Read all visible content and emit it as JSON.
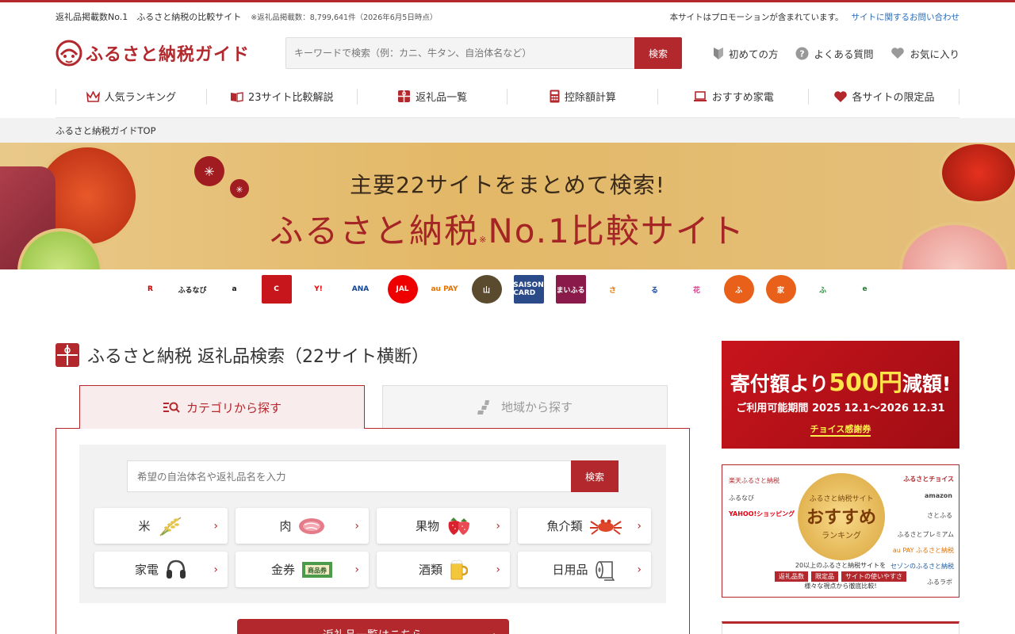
{
  "header": {
    "tagline": "返礼品掲載数No.1　ふるさと納税の比較サイト",
    "count_note": "※返礼品掲載数：8,799,641件（2026年6月5日時点）",
    "promo_note": "本サイトはプロモーションが含まれています。",
    "contact_link": "サイトに関するお問い合わせ",
    "logo_text": "ふるさと納税ガイド",
    "search_placeholder": "キーワードで検索（例：カニ、牛タン、自治体名など）",
    "search_button": "検索",
    "links": [
      {
        "label": "初めての方",
        "icon": "beginner-icon"
      },
      {
        "label": "よくある質問",
        "icon": "question-icon"
      },
      {
        "label": "お気に入り",
        "icon": "heart-icon"
      }
    ]
  },
  "nav": [
    {
      "label": "人気ランキング",
      "icon": "crown-icon"
    },
    {
      "label": "23サイト比較解説",
      "icon": "book-icon"
    },
    {
      "label": "返礼品一覧",
      "icon": "gift-icon"
    },
    {
      "label": "控除額計算",
      "icon": "calculator-icon"
    },
    {
      "label": "おすすめ家電",
      "icon": "laptop-icon"
    },
    {
      "label": "各サイトの限定品",
      "icon": "heart-icon"
    }
  ],
  "breadcrumb": "ふるさと納税ガイドTOP",
  "hero": {
    "line1": "主要22サイトをまとめて検索!",
    "line2a": "ふるさと納税",
    "line2mark": "※",
    "line2b": "No.1比較サイト",
    "site_logos": [
      "R",
      "ふるなび",
      "a",
      "C",
      "Y!",
      "ANA",
      "JAL",
      "au PAY",
      "山",
      "SAISON CARD",
      "まいふる",
      "さ",
      "る",
      "花",
      "ふ",
      "家",
      "ふ",
      "e"
    ]
  },
  "search_section": {
    "title": "ふるさと納税 返礼品検索（22サイト横断）",
    "tab_category": "カテゴリから探す",
    "tab_region": "地域から探す",
    "input_placeholder": "希望の自治体名や返礼品名を入力",
    "search_button": "検索",
    "categories": [
      {
        "label": "米",
        "icon": "rice-icon"
      },
      {
        "label": "肉",
        "icon": "meat-icon"
      },
      {
        "label": "果物",
        "icon": "strawberry-icon"
      },
      {
        "label": "魚介類",
        "icon": "crab-icon"
      },
      {
        "label": "家電",
        "icon": "headphones-icon"
      },
      {
        "label": "金券",
        "icon": "gift-voucher-icon"
      },
      {
        "label": "酒類",
        "icon": "beer-icon"
      },
      {
        "label": "日用品",
        "icon": "toilet-paper-icon"
      }
    ],
    "cta": "返礼品一覧はこちら"
  },
  "ads": {
    "ad1_line1a": "寄付額より",
    "ad1_amount": "500円",
    "ad1_line1b": "減額!",
    "ad1_line2": "ご利用可能期間 2025 12.1～2026 12.31",
    "ad1_line3": "チョイス感謝券",
    "ad2_m1": "ふるさと納税サイト",
    "ad2_m2": "おすすめ",
    "ad2_m3": "ランキング",
    "ad2_foot": "20以上のふるさと納税サイトを",
    "ad2_tags": [
      "返礼品数",
      "限定品",
      "サイトの使いやすさ"
    ],
    "ad2_foot2": "様々な視点から徹底比較!",
    "ad2_sites_left": [
      "楽天ふるさと納税",
      "ふるなび",
      "YAHOO!ショッピング"
    ],
    "ad2_sites_right": [
      "ふるさとチョイス",
      "amazon",
      "さとふる",
      "ふるさとプレミアム",
      "au PAY ふるさと納税",
      "セゾンのふるさと納税",
      "ふるラボ"
    ]
  },
  "colors": {
    "brand": "#b3282d",
    "link": "#2a6bb5",
    "gold": "#e3b867"
  }
}
